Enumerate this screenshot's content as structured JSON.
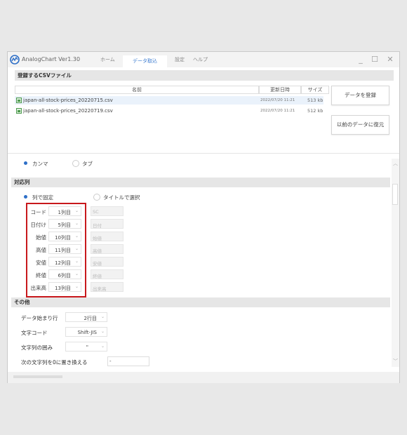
{
  "app": {
    "title": "AnalogChart Ver1.30"
  },
  "tabs": [
    {
      "label": "ホーム"
    },
    {
      "label": "データ取込"
    },
    {
      "label": "設定"
    },
    {
      "label": "ヘルプ"
    }
  ],
  "window_controls": {
    "minimize": "_",
    "maximize": "☐",
    "close": "✕"
  },
  "csv_section": {
    "title": "登録するCSVファイル",
    "columns": [
      "名前",
      "更新日時",
      "サイズ"
    ],
    "files": [
      {
        "name": "japan-all-stock-prices_20220715.csv",
        "date": "2022/07/20 11:21",
        "size": "513 kb"
      },
      {
        "name": "japan-all-stock-prices_20220719.csv",
        "date": "2022/07/20 11:21",
        "size": "512 kb"
      }
    ]
  },
  "buttons": {
    "register": "データを登録",
    "restore": "以前のデータに復元"
  },
  "delimiter": {
    "comma": "カンマ",
    "tab": "タブ"
  },
  "column_mapping": {
    "title": "対応列",
    "mode_fixed": "列で固定",
    "mode_title": "タイトルで選択",
    "fields": [
      {
        "label": "コード",
        "value": "1列目",
        "title": "SC"
      },
      {
        "label": "日付け",
        "value": "5列目",
        "title": "日付"
      },
      {
        "label": "始値",
        "value": "10列目",
        "title": "始値"
      },
      {
        "label": "高値",
        "value": "11列目",
        "title": "高値"
      },
      {
        "label": "安値",
        "value": "12列目",
        "title": "安値"
      },
      {
        "label": "終値",
        "value": "6列目",
        "title": "終値"
      },
      {
        "label": "出来高",
        "value": "13列目",
        "title": "出来高"
      }
    ]
  },
  "other": {
    "title": "その他",
    "start_row_label": "データ始まり行",
    "start_row_value": "2行目",
    "encoding_label": "文字コード",
    "encoding_value": "Shift-JIS",
    "quote_label": "文字列の囲み",
    "quote_value": "\"",
    "replace_label": "次の文字列を0に置き換える",
    "replace_value": "-"
  },
  "colors": {
    "accent": "#2e6fc7",
    "highlight_border": "#c8181c",
    "section_bg": "#e6e6e6"
  },
  "icons": {
    "logo": "analogchart-logo-icon",
    "file": "csv-file-icon"
  }
}
